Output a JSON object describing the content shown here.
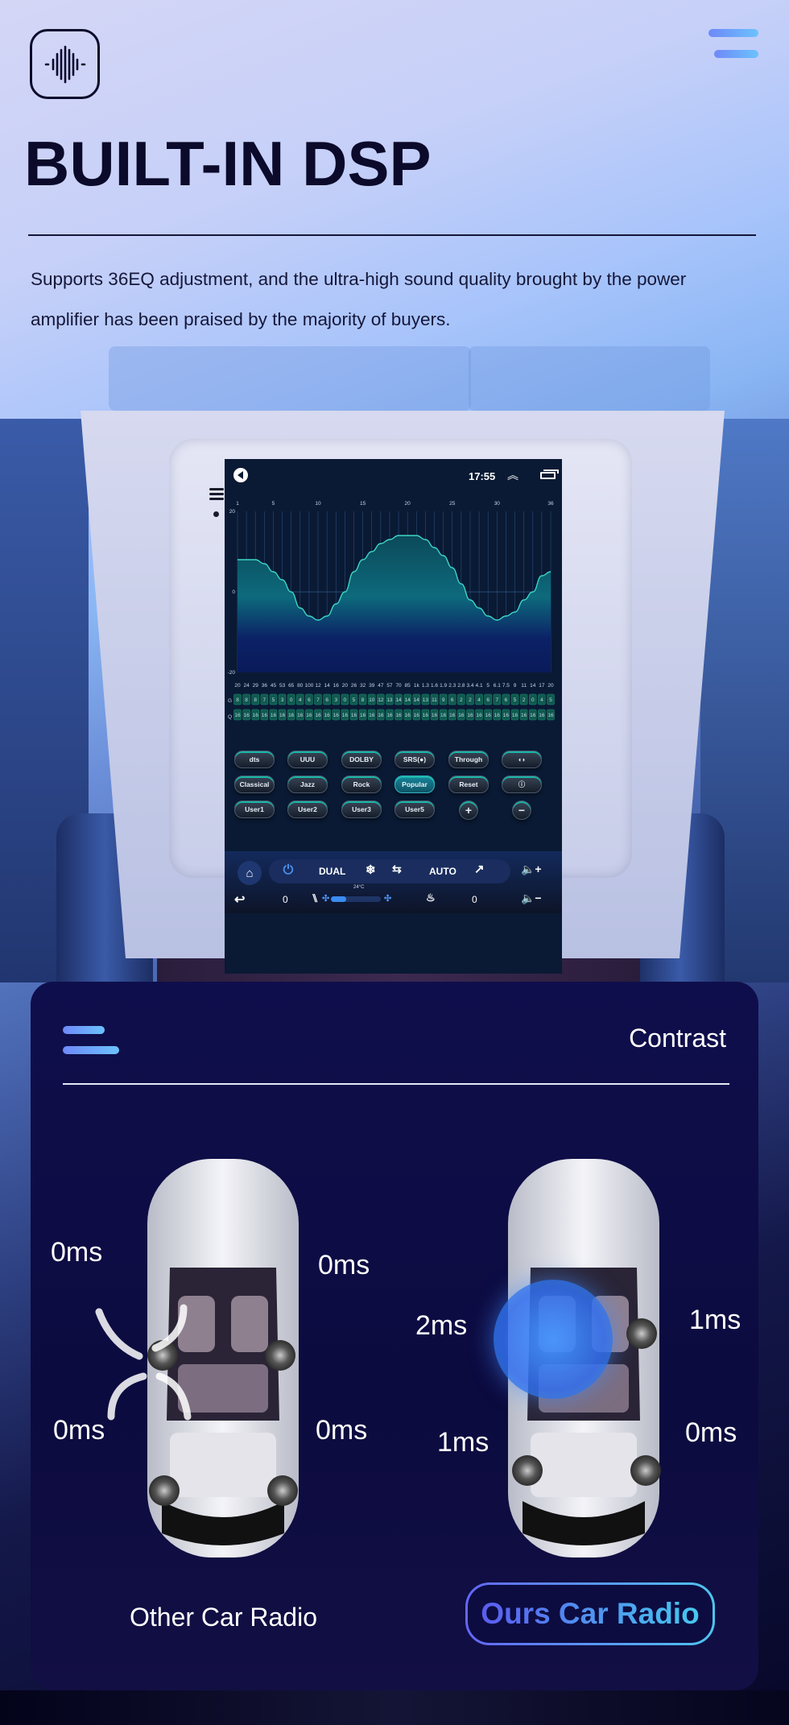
{
  "header": {
    "title": "BUILT-IN DSP",
    "description": "Supports 36EQ adjustment, and the ultra-high sound quality brought by the power amplifier has been praised by the majority of buyers.",
    "icons": {
      "logo": "sound-wave-icon",
      "menu": "menu-icon"
    }
  },
  "head_unit": {
    "status_bar": {
      "time": "17:55",
      "icons": [
        "volume-back-icon",
        "double-chevron-up-icon",
        "recent-apps-icon"
      ]
    },
    "eq": {
      "band_count": 36,
      "band_number_ticks": [
        "1",
        "5",
        "10",
        "15",
        "20",
        "25",
        "30",
        "36"
      ],
      "y_ticks": [
        "20",
        "0",
        "-20"
      ],
      "row_labels": {
        "gain": "G",
        "q": "Q"
      },
      "frequencies": [
        "20",
        "24",
        "29",
        "36",
        "45",
        "53",
        "65",
        "80",
        "100",
        "12",
        "14",
        "16",
        "20",
        "26",
        "32",
        "39",
        "47",
        "57",
        "70",
        "85",
        "1k",
        "1.3",
        "1.6",
        "1.9",
        "2.3",
        "2.8",
        "3.4",
        "4.1",
        "5",
        "6.1",
        "7.5",
        "9",
        "11",
        "14",
        "17",
        "20"
      ],
      "highlight_frequencies": [
        "100",
        "1k"
      ],
      "gains": [
        "8",
        "8",
        "8",
        "7",
        "5",
        "3",
        "0",
        "-4",
        "-6",
        "-7",
        "-6",
        "-3",
        "0",
        "5",
        "8",
        "10",
        "12",
        "13",
        "14",
        "14",
        "14",
        "13",
        "11",
        "9",
        "6",
        "2",
        "-2",
        "-4",
        "-6",
        "-7",
        "-6",
        "-5",
        "-2",
        "0",
        "4",
        "5"
      ],
      "q_values": [
        "16",
        "16",
        "16",
        "16",
        "16",
        "16",
        "16",
        "16",
        "16",
        "16",
        "16",
        "16",
        "16",
        "16",
        "16",
        "16",
        "16",
        "16",
        "16",
        "16",
        "16",
        "16",
        "16",
        "16",
        "16",
        "16",
        "16",
        "16",
        "16",
        "16",
        "16",
        "16",
        "16",
        "16",
        "16",
        "16"
      ]
    },
    "presets": {
      "row1": [
        "dts",
        "UUU",
        "DOLBY",
        "SRS(●)",
        "Through",
        "◖◗"
      ],
      "row2": [
        "Classical",
        "Jazz",
        "Rock",
        "Popular",
        "Reset",
        "ⓘ"
      ],
      "row3": [
        "User1",
        "User2",
        "User3",
        "User5",
        "+",
        "−"
      ],
      "active": "Popular"
    },
    "climate": {
      "top": {
        "home": "⌂",
        "dual": "DUAL",
        "auto": "AUTO",
        "temp": "24°C"
      },
      "bottom": {
        "left_value": "0",
        "right_value": "0"
      },
      "fan_level": 0.3,
      "icons": [
        "home-icon",
        "power-icon",
        "snowflake-icon",
        "recirculate-icon",
        "airflow-icon",
        "volume-up-icon",
        "back-icon",
        "seat-icon",
        "fan-icon",
        "seat-heat-icon",
        "volume-down-icon"
      ]
    }
  },
  "contrast": {
    "title": "Contrast",
    "other": {
      "caption": "Other Car Radio",
      "delays": {
        "front_left": "0ms",
        "front_right": "0ms",
        "rear_left": "0ms",
        "rear_right": "0ms"
      }
    },
    "ours": {
      "caption": "Ours Car Radio",
      "delays": {
        "front_left": "2ms",
        "front_right": "1ms",
        "rear_left": "1ms",
        "rear_right": "0ms"
      }
    },
    "colors": {
      "gradient_start": "#6466f7",
      "gradient_end": "#4ec4ef",
      "card_bg": "#0f0e4c"
    }
  }
}
